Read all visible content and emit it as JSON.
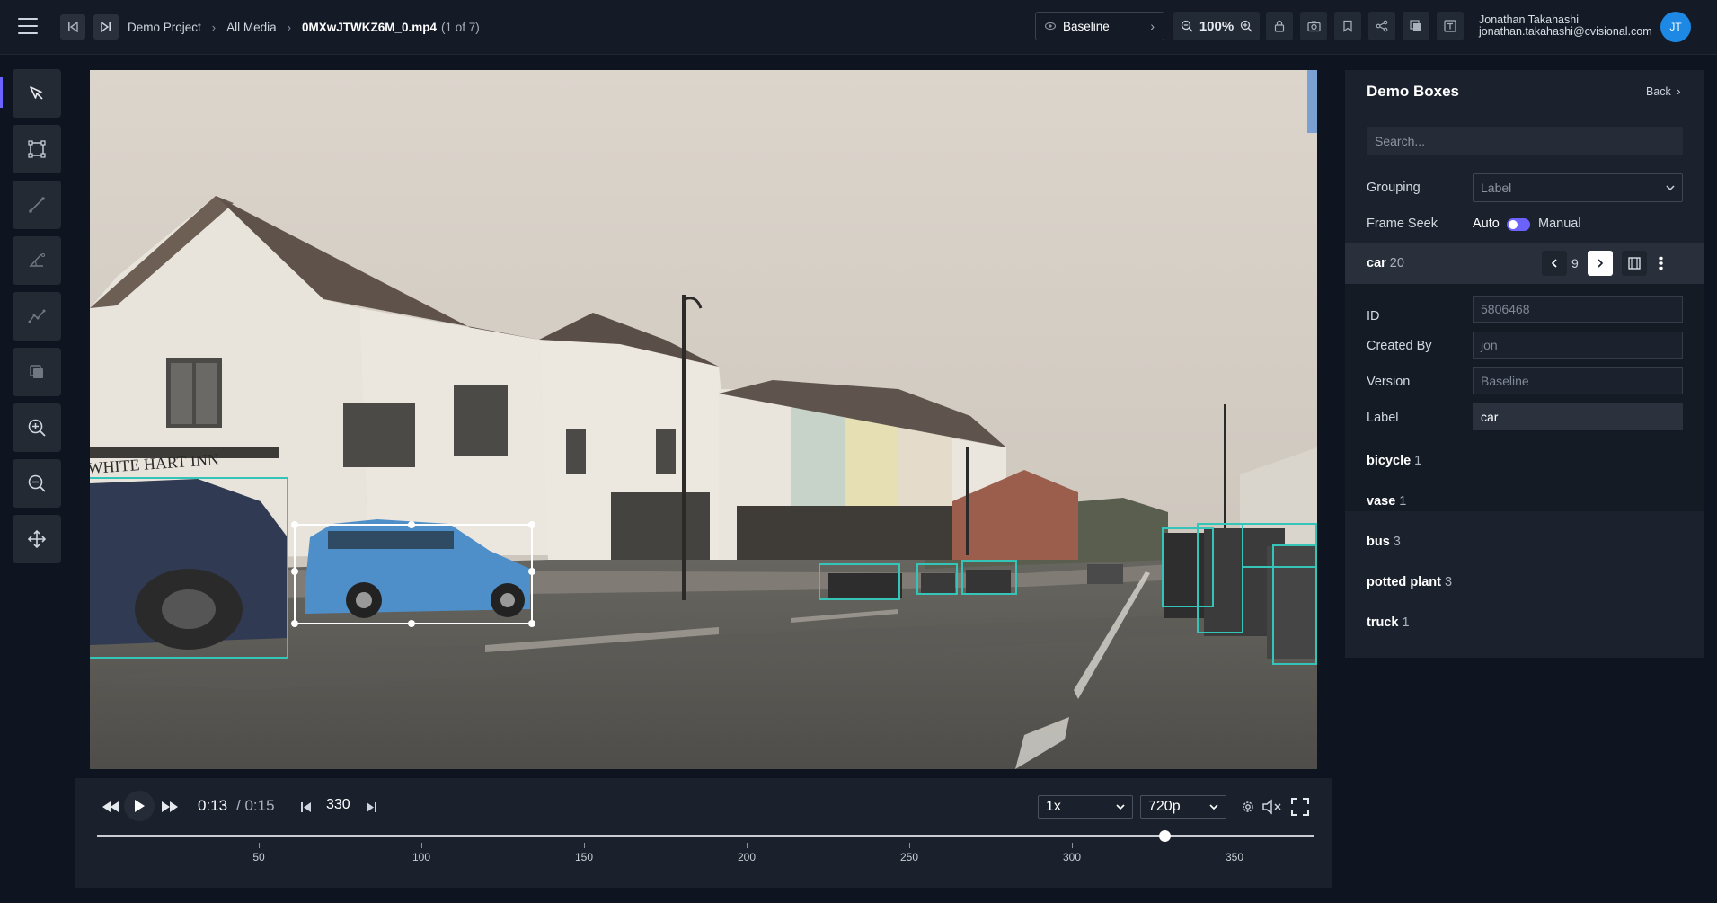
{
  "header": {
    "breadcrumb": [
      "Demo Project",
      "All Media"
    ],
    "file_name": "0MXwJTWKZ6M_0.mp4",
    "file_count": "(1 of 7)",
    "version_select": "Baseline",
    "zoom": "100%",
    "user_name": "Jonathan Takahashi",
    "user_email": "jonathan.takahashi@cvisional.com",
    "avatar_initials": "JT"
  },
  "toolbar": {
    "tools": [
      "select-tool",
      "bounding-box-tool",
      "line-tool",
      "angle-tool",
      "polyline-tool",
      "copy-tool",
      "zoom-in-tool",
      "zoom-out-tool",
      "pan-tool"
    ],
    "active_tool": "select-tool"
  },
  "video": {
    "scene": "street scene with buildings and parked cars",
    "sign_text": "WHITE HART INN",
    "box_color": "#35c4b8",
    "selected_box_color": "#ffffff",
    "annotation_count_visible": 9
  },
  "player": {
    "current_time": "0:13",
    "duration": "/ 0:15",
    "frame": "330",
    "speed": "1x",
    "quality": "720p",
    "timeline_ticks": [
      "50",
      "100",
      "150",
      "200",
      "250",
      "300",
      "350"
    ],
    "progress_fraction": 0.877
  },
  "panel": {
    "title": "Demo Boxes",
    "back_label": "Back",
    "search_placeholder": "Search...",
    "grouping_label": "Grouping",
    "grouping_value": "Label",
    "frame_seek_label": "Frame Seek",
    "frame_seek_auto": "Auto",
    "frame_seek_manual": "Manual",
    "selected_class": {
      "name": "car",
      "count": "20",
      "index": "9"
    },
    "details": [
      {
        "label": "ID",
        "value": "5806468"
      },
      {
        "label": "Created By",
        "value": "jon"
      },
      {
        "label": "Version",
        "value": "Baseline"
      },
      {
        "label": "Label",
        "value": "car"
      }
    ],
    "classes": [
      {
        "name": "bicycle",
        "count": "1"
      },
      {
        "name": "vase",
        "count": "1"
      },
      {
        "name": "bus",
        "count": "3"
      },
      {
        "name": "potted plant",
        "count": "3"
      },
      {
        "name": "truck",
        "count": "1"
      }
    ]
  }
}
